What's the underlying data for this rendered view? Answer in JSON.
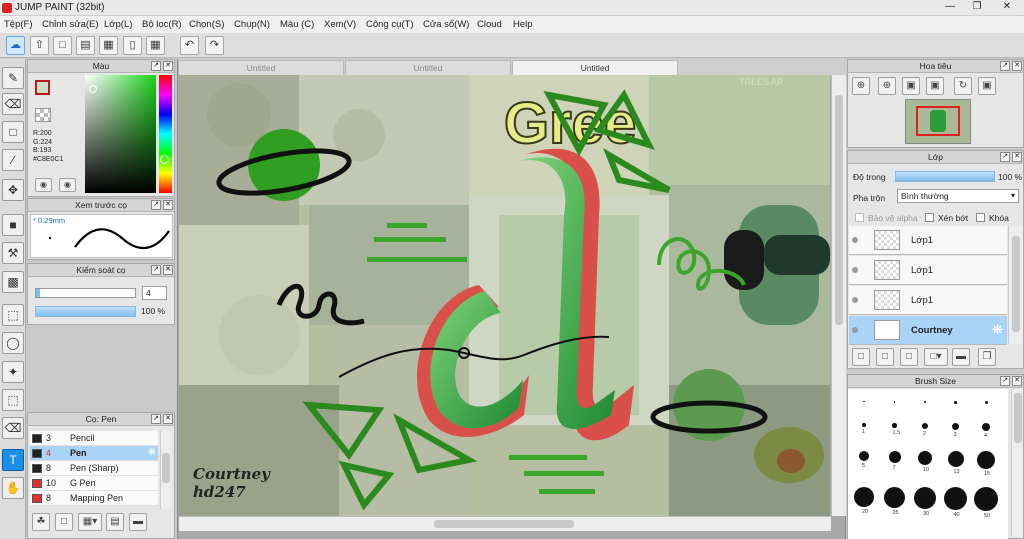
{
  "window": {
    "title": "JUMP PAINT (32bit)"
  },
  "menu": [
    "Tệp(F)",
    "Chỉnh sửa(E)",
    "Lớp(L)",
    "Bộ lọc(R)",
    "Chọn(S)",
    "Chụp(N)",
    "Màu (C)",
    "Xem(V)",
    "Công cụ(T)",
    "Cửa sổ(W)",
    "Cloud",
    "Help"
  ],
  "color_panel": {
    "title": "Màu",
    "r": "R:200",
    "g": "G:224",
    "b": "B:193",
    "hex": "#C8E0C1",
    "main_color": "#c8e0c1"
  },
  "brush_preview": {
    "title": "Xem trước cọ",
    "size": "0.29mm"
  },
  "brush_control": {
    "title": "Kiểm soát cọ",
    "size_value": "4",
    "opacity_value": "100 %"
  },
  "brush_list": {
    "title": "Cọ: Pen",
    "items": [
      {
        "size": "3",
        "name": "Pencil",
        "color": "#222222"
      },
      {
        "size": "4",
        "name": "Pen",
        "color": "#222222"
      },
      {
        "size": "8",
        "name": "Pen (Sharp)",
        "color": "#222222"
      },
      {
        "size": "10",
        "name": "G Pen",
        "color": "#e03030"
      },
      {
        "size": "8",
        "name": "Mapping Pen",
        "color": "#e03030"
      }
    ]
  },
  "tabs": [
    "Untitled",
    "Untitled",
    "Untitled"
  ],
  "navigator": {
    "title": "Hoa tiêu"
  },
  "layers": {
    "title": "Lớp",
    "opacity_label": "Độ trong",
    "opacity_value": "100 %",
    "blend_label": "Pha trộn",
    "blend_value": "Bình thường",
    "protect_alpha": "Bảo vệ alpha",
    "clip": "Xén bớt",
    "lock": "Khóa",
    "items": [
      "Lớp1",
      "Lớp1",
      "Lớp1",
      "Courtney"
    ]
  },
  "brush_size": {
    "title": "Brush Size",
    "labels": [
      "1",
      "1.5",
      "2",
      "3",
      "4",
      "5",
      "7",
      "10",
      "13",
      "15",
      "20",
      "25",
      "30",
      "40",
      "50"
    ]
  },
  "artwork": {
    "signature_line1": "Courtney",
    "signature_line2": "hd247",
    "green_text": "Gree",
    "trees_text": "TREES AR",
    "accent": "#2e9a3a"
  }
}
